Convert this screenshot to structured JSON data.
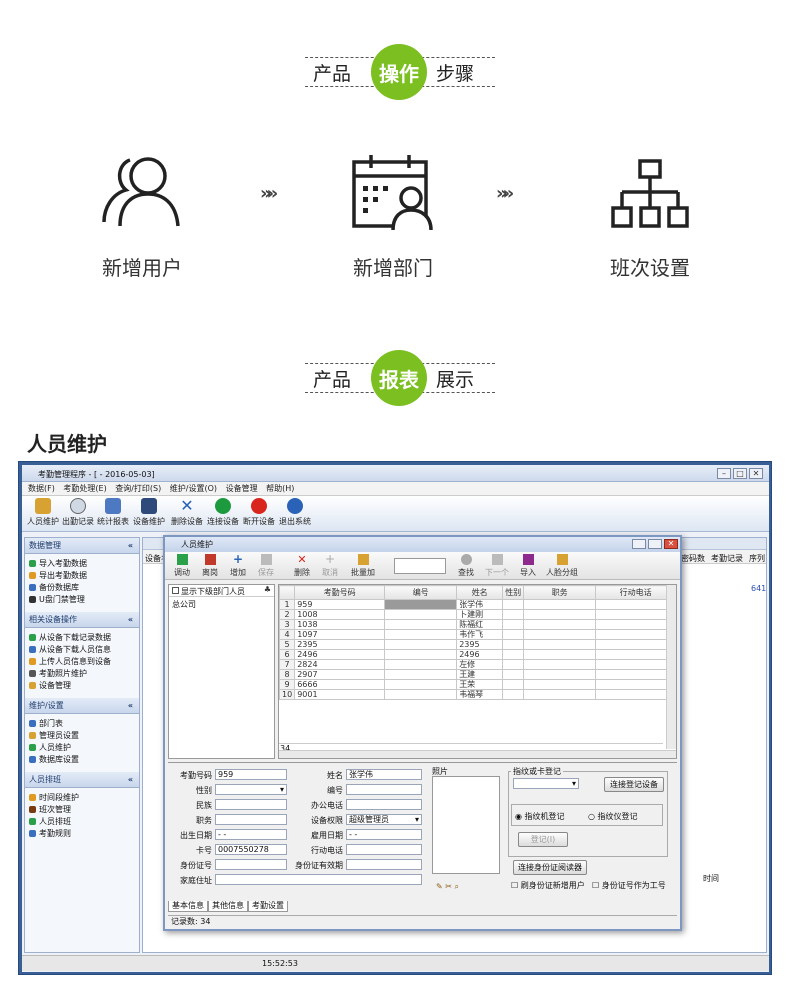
{
  "section1": {
    "left": "产品",
    "circle": "操作",
    "right": "步骤"
  },
  "steps": [
    {
      "icon": "users-icon",
      "label": "新增用户"
    },
    {
      "icon": "calendar-person-icon",
      "label": "新增部门"
    },
    {
      "icon": "org-chart-icon",
      "label": "班次设置"
    }
  ],
  "step_arrow": "»»",
  "section2": {
    "left": "产品",
    "circle": "报表",
    "right": "展示"
  },
  "heading": "人员维护",
  "colors": {
    "accent_green": "#7bbf21",
    "window_blue": "#3a5f95"
  },
  "app": {
    "title": "考勤管理程序 - [ - 2016-05-03]",
    "menu": [
      "数据(F)",
      "考勤处理(E)",
      "查询/打印(S)",
      "维护/设置(O)",
      "设备管理",
      "帮助(H)"
    ],
    "toolbar": [
      "人员维护",
      "出勤记录",
      "统计报表",
      "设备维护",
      "删除设备",
      "连接设备",
      "断开设备",
      "退出系统"
    ],
    "sidebar": [
      {
        "title": "数据管理",
        "items": [
          "导入考勤数据",
          "导出考勤数据",
          "备份数据库",
          "U盘门禁管理"
        ]
      },
      {
        "title": "相关设备操作",
        "items": [
          "从设备下载记录数据",
          "从设备下载人员信息",
          "上传人员信息到设备",
          "考勤照片维护",
          "设备管理"
        ]
      },
      {
        "title": "维护/设置",
        "items": [
          "部门表",
          "管理员设置",
          "人员维护",
          "数据库设置"
        ]
      },
      {
        "title": "人员排班",
        "items": [
          "时间段维护",
          "班次管理",
          "人员排班",
          "考勤规则"
        ]
      }
    ],
    "bg_headers": [
      "设备名",
      "密码数",
      "考勤记录",
      "序列"
    ],
    "bg_value": "641",
    "bg_time_header": "时间",
    "status_time": "15:52:53"
  },
  "dialog": {
    "title": "人员维护",
    "tools": [
      "调动",
      "离岗",
      "增加",
      "保存",
      "删除",
      "取消",
      "批量加",
      "查找",
      "下一个",
      "导入",
      "人脸分组"
    ],
    "tree_checkbox": "显示下级部门人员",
    "tree_root": "总公司",
    "columns": [
      "考勤号码",
      "编号",
      "姓名",
      "性别",
      "职务",
      "行动电话"
    ],
    "rows": [
      [
        "1",
        "959",
        "",
        "张学伟"
      ],
      [
        "2",
        "1008",
        "",
        "卜建刚"
      ],
      [
        "3",
        "1038",
        "",
        "陈福红"
      ],
      [
        "4",
        "1097",
        "",
        "韦作飞"
      ],
      [
        "5",
        "2395",
        "",
        "2395"
      ],
      [
        "6",
        "2496",
        "",
        "2496"
      ],
      [
        "7",
        "2824",
        "",
        "左修"
      ],
      [
        "8",
        "2907",
        "",
        "王建"
      ],
      [
        "9",
        "6666",
        "",
        "王荣"
      ],
      [
        "10",
        "9001",
        "",
        "韦福琴"
      ]
    ],
    "last_row_num": "34",
    "form": {
      "att_no_label": "考勤号码",
      "att_no": "959",
      "name_label": "姓名",
      "name": "张学伟",
      "gender_label": "性别",
      "number_label": "编号",
      "ethnic_label": "民族",
      "office_phone_label": "办公电话",
      "position_label": "职务",
      "perm_label": "设备权限",
      "perm": "超级管理员",
      "birth_label": "出生日期",
      "birth": "-  -",
      "hire_label": "雇用日期",
      "hire": "-  -",
      "card_label": "卡号",
      "card": "0007550278",
      "mobile_label": "行动电话",
      "idcard_label": "身份证号",
      "id_valid_label": "身份证有效期",
      "address_label": "家庭住址",
      "photo_label": "照片",
      "fp_label": "指纹或卡登记",
      "connect_reg_btn": "连接登记设备",
      "fp_machine": "指纹机登记",
      "fp_device": "指纹仪登记",
      "register_btn": "登记(I)",
      "connect_id_btn": "连接身份证阅读器",
      "swipe_id": "刷身份证新增用户",
      "id_as_no": "身份证号作为工号"
    },
    "tabs": [
      "基本信息",
      "其他信息",
      "考勤设置"
    ],
    "record_count": "记录数: 34"
  }
}
